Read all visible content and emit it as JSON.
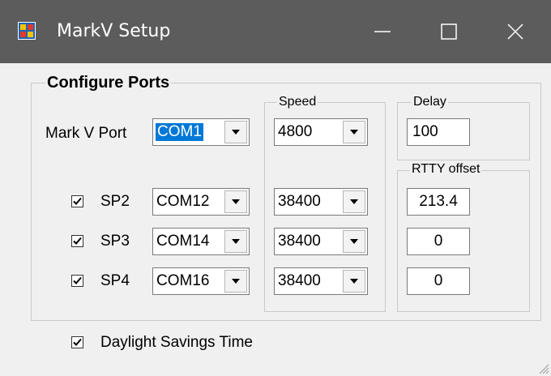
{
  "window": {
    "title": "MarkV Setup"
  },
  "titlebar": {
    "icons": {
      "app": "app-icon",
      "minimize": "minimize-icon",
      "maximize": "maximize-icon",
      "close": "close-icon"
    }
  },
  "groups": {
    "configure_ports": "Configure Ports",
    "speed": "Speed",
    "delay": "Delay",
    "rtty_offset": "RTTY offset"
  },
  "mark_v_port": {
    "label": "Mark V Port",
    "port": "COM1",
    "speed": "4800"
  },
  "delay": {
    "value": "100"
  },
  "ports": [
    {
      "label": "SP2",
      "checked": true,
      "port": "COM12",
      "speed": "38400",
      "rtty_offset": "213.4"
    },
    {
      "label": "SP3",
      "checked": true,
      "port": "COM14",
      "speed": "38400",
      "rtty_offset": "0"
    },
    {
      "label": "SP4",
      "checked": true,
      "port": "COM16",
      "speed": "38400",
      "rtty_offset": "0"
    }
  ],
  "dst": {
    "label": "Daylight Savings Time",
    "checked": true
  },
  "colors": {
    "titlebar": "#5c5c5c",
    "selection": "#0078d7",
    "background": "#f0f0f0"
  }
}
